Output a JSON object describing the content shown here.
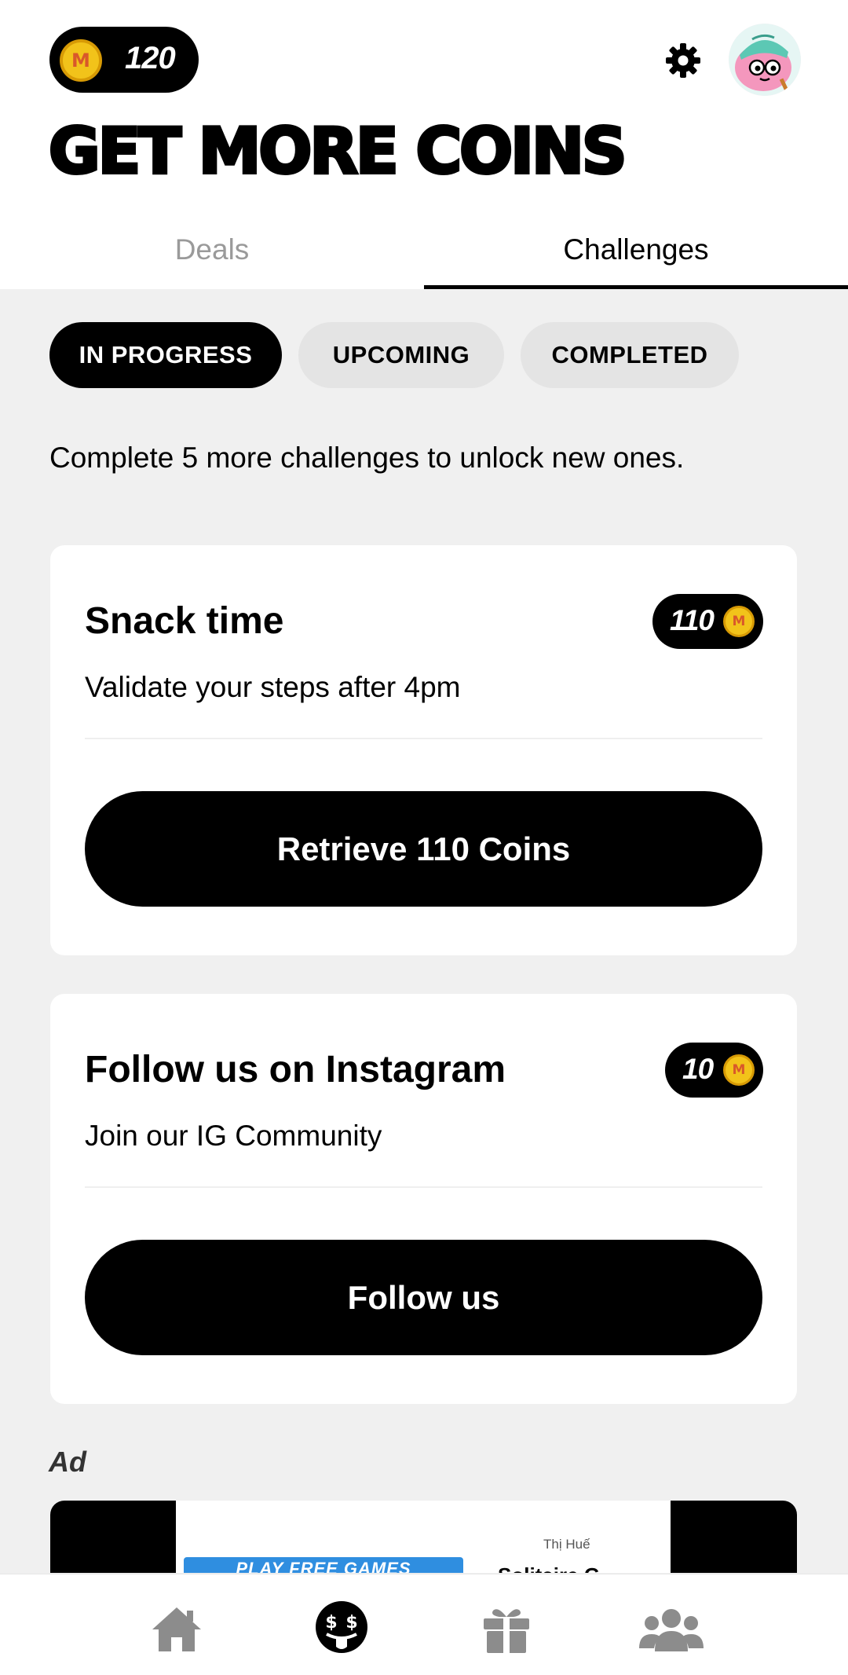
{
  "header": {
    "coin_balance": "120",
    "coin_symbol": "M",
    "title": "GET MORE COINS"
  },
  "tabs": [
    {
      "label": "Deals",
      "active": false
    },
    {
      "label": "Challenges",
      "active": true
    }
  ],
  "filters": [
    {
      "label": "IN PROGRESS",
      "active": true
    },
    {
      "label": "UPCOMING",
      "active": false
    },
    {
      "label": "COMPLETED",
      "active": false
    }
  ],
  "info_text": "Complete 5 more challenges to unlock new ones.",
  "challenges": [
    {
      "title": "Snack time",
      "subtitle": "Validate your steps after 4pm",
      "reward": "110",
      "button_label": "Retrieve 110 Coins"
    },
    {
      "title": "Follow us on Instagram",
      "subtitle": "Join our IG Community",
      "reward": "10",
      "button_label": "Follow us"
    }
  ],
  "ad": {
    "label": "Ad",
    "banner_text": "PLAY FREE GAMES",
    "advertiser": "Thị Huế",
    "title": "Solitaire G"
  },
  "bottom_nav": [
    {
      "icon": "home-icon",
      "active": false
    },
    {
      "icon": "money-face-icon",
      "active": true
    },
    {
      "icon": "gift-icon",
      "active": false
    },
    {
      "icon": "friends-icon",
      "active": false
    }
  ],
  "colors": {
    "coin_gold": "#f2c31a",
    "coin_rim": "#d79a05",
    "coin_letter": "#d9582a",
    "page_background": "#f0f0f0",
    "inactive_tab": "#9a9a9a",
    "inactive_nav": "#8c8c8c",
    "active_chip": "#000000",
    "inactive_chip": "#e4e4e4"
  }
}
